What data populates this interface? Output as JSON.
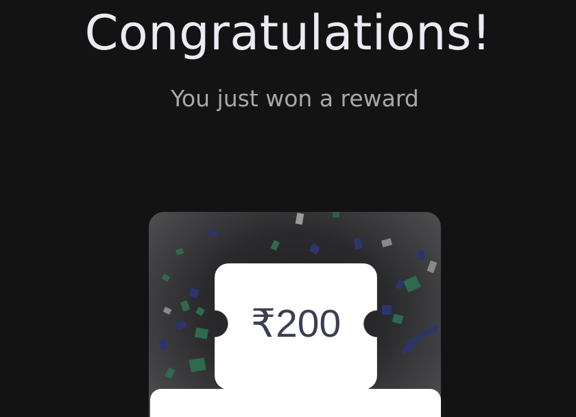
{
  "header": {
    "title": "Congratulations!",
    "subtitle": "You just won a reward"
  },
  "reward": {
    "amount": "₹200"
  },
  "colors": {
    "background": "#131313",
    "title": "#ecebf3",
    "subtitle": "#a8a8ad",
    "ticket": "#ffffff",
    "amount_text": "#3c3f52",
    "confetti_green": "#2e6b4e",
    "confetti_blue": "#2c3470",
    "confetti_gray": "#8a8a8a"
  }
}
